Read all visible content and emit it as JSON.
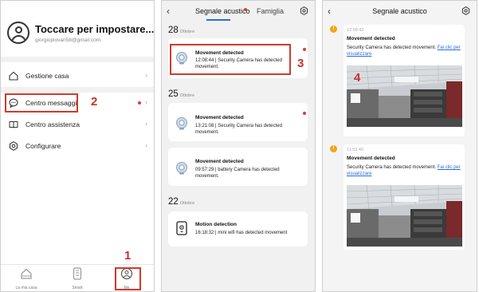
{
  "panel_me": {
    "profile_name": "Toccare per impostare...",
    "profile_email": "giorgiopiovan58@gmail.com",
    "menu": [
      {
        "label": "Gestione casa",
        "icon": "home-icon"
      },
      {
        "label": "Centro messaggi",
        "icon": "message-icon"
      },
      {
        "label": "Centro assistenza",
        "icon": "book-icon"
      },
      {
        "label": "Configurare",
        "icon": "settings-icon"
      }
    ],
    "tabs": [
      {
        "label": "La mia casa",
        "icon": "house-icon"
      },
      {
        "label": "Smart",
        "icon": "smart-icon"
      },
      {
        "label": "Me",
        "icon": "me-icon"
      }
    ],
    "chevron": "›"
  },
  "panel_messages": {
    "back": "‹",
    "tab_active": "Segnale acustico",
    "tab_inactive": "Famiglia",
    "groups": [
      {
        "day": "28",
        "month": "Ottobre",
        "items": [
          {
            "title": "Movement detected",
            "body": "12:08:44 | Security Camera has detected movement."
          }
        ]
      },
      {
        "day": "25",
        "month": "Ottobre",
        "items": [
          {
            "title": "Movement detected",
            "body": "13:21:08 | Security Camera has detected movement."
          },
          {
            "title": "Movement detected",
            "body": "09:57:29 | battery Camera has detected movement."
          }
        ]
      },
      {
        "day": "22",
        "month": "Ottobre",
        "items": [
          {
            "title": "Motion detection",
            "body": "16:18:32 | mini wifi has detected movement"
          }
        ]
      }
    ]
  },
  "panel_detail": {
    "back": "‹",
    "title": "Segnale acustico",
    "notices": [
      {
        "time": "12:08:42",
        "title": "Movement detected",
        "text": "Security Camera has detected movement.",
        "link": "Fai clic per visualizzare"
      },
      {
        "time": "11:53:40",
        "title": "Movement detected",
        "text": "Security Camera has detected movement.",
        "link": "Fai clic per visualizzare"
      }
    ],
    "warn_symbol": "!"
  },
  "callouts": [
    "1",
    "2",
    "3",
    "4"
  ],
  "colors": {
    "accent": "#2b6cd8",
    "callout": "#d23a2c",
    "warning": "#f2a516"
  }
}
